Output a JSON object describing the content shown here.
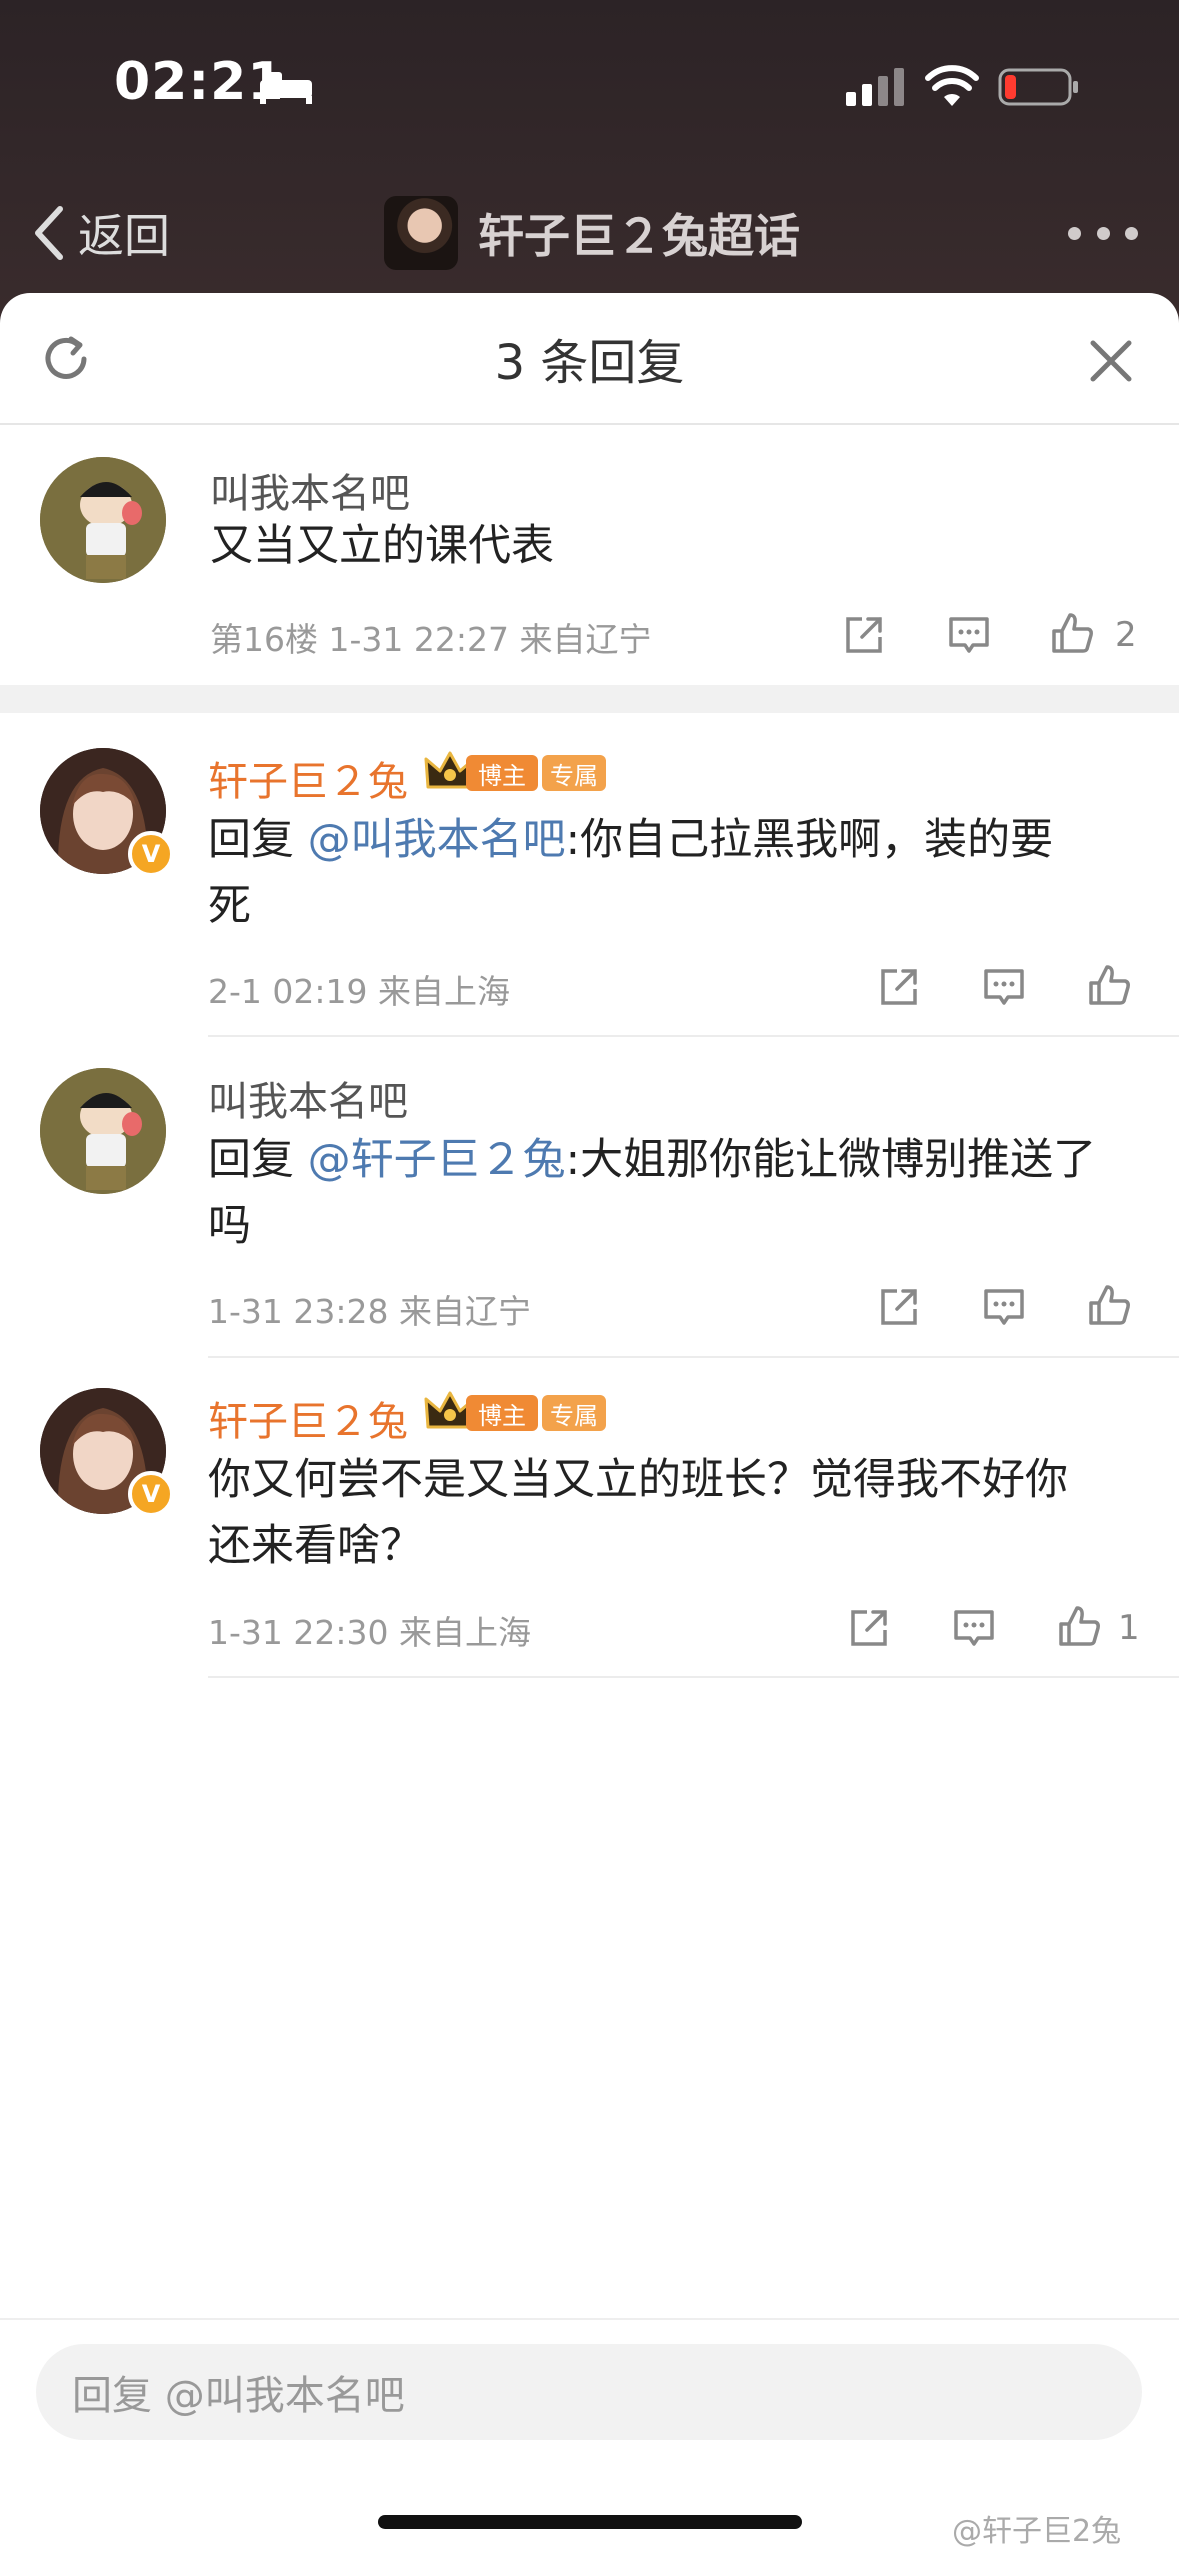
{
  "status_bar": {
    "time": "02:21"
  },
  "nav": {
    "back_label": "返回",
    "title": "轩子巨２兔超话"
  },
  "sheet": {
    "title": "3 条回复"
  },
  "root_comment": {
    "username": "叫我本名吧",
    "text": "又当又立的课代表",
    "meta": "第16楼 1-31 22:27 来自辽宁",
    "likes": "2"
  },
  "replies": [
    {
      "username": "轩子巨２兔",
      "badges": [
        "博主",
        "专属"
      ],
      "prefix": "回复 ",
      "mention": "@叫我本名吧",
      "text_line1": ":你自己拉黑我啊，装的要",
      "text_line2": "死",
      "meta": "2-1 02:19 来自上海",
      "likes": ""
    },
    {
      "username": "叫我本名吧",
      "prefix": "回复 ",
      "mention": "@轩子巨２兔",
      "text_line1": ":大姐那你能让微博别推送了",
      "text_line2": "吗",
      "meta": "1-31 23:28 来自辽宁",
      "likes": ""
    },
    {
      "username": "轩子巨２兔",
      "badges": [
        "博主",
        "专属"
      ],
      "text_line1": "你又何尝不是又当又立的班长？觉得我不好你",
      "text_line2": "还来看啥？",
      "meta": "1-31 22:30 来自上海",
      "likes": "1"
    }
  ],
  "reply_box": {
    "placeholder": "回复 @叫我本名吧"
  },
  "watermark": "@轩子巨2兔",
  "colors": {
    "accent_orange": "#e8742d",
    "mention_blue": "#4e7ab0",
    "vip_badge": "#f5a623"
  }
}
